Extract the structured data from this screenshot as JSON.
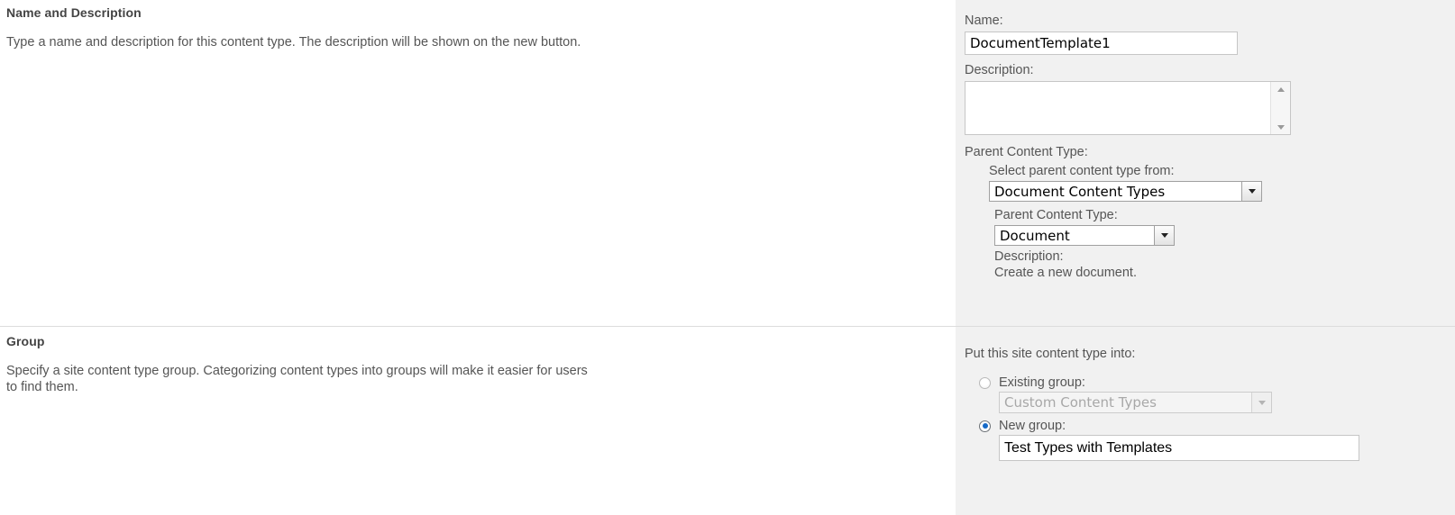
{
  "sections": [
    {
      "title": "Name and Description",
      "description": "Type a name and description for this content type. The description will be shown on the new button."
    },
    {
      "title": "Group",
      "description": "Specify a site content type group. Categorizing content types into groups will make it easier for users to find them."
    }
  ],
  "name_field": {
    "label": "Name:",
    "value": "DocumentTemplate1"
  },
  "description_field": {
    "label": "Description:",
    "value": "",
    "scroll_up_icon": "triangle-up-icon",
    "scroll_down_icon": "triangle-down-icon"
  },
  "parent_content_type": {
    "label": "Parent Content Type:",
    "source_label": "Select parent content type from:",
    "source_value": "Document Content Types",
    "type_label": "Parent Content Type:",
    "type_value": "Document",
    "description_label": "Description:",
    "description_value": "Create a new document.",
    "dropdown_icon": "chevron-down-icon"
  },
  "group": {
    "put_into_label": "Put this site content type into:",
    "existing_group_label": "Existing group:",
    "existing_group_value": "Custom Content Types",
    "existing_group_selected": false,
    "new_group_label": "New group:",
    "new_group_value": "Test Types with Templates",
    "new_group_selected": true,
    "dropdown_icon": "chevron-down-icon"
  },
  "colors": {
    "panel_background": "#f1f1f1",
    "page_background": "#ffffff",
    "text": "#555555",
    "heading": "#444444",
    "divider": "#dcdcdc",
    "radio_accent": "#1569c7"
  }
}
